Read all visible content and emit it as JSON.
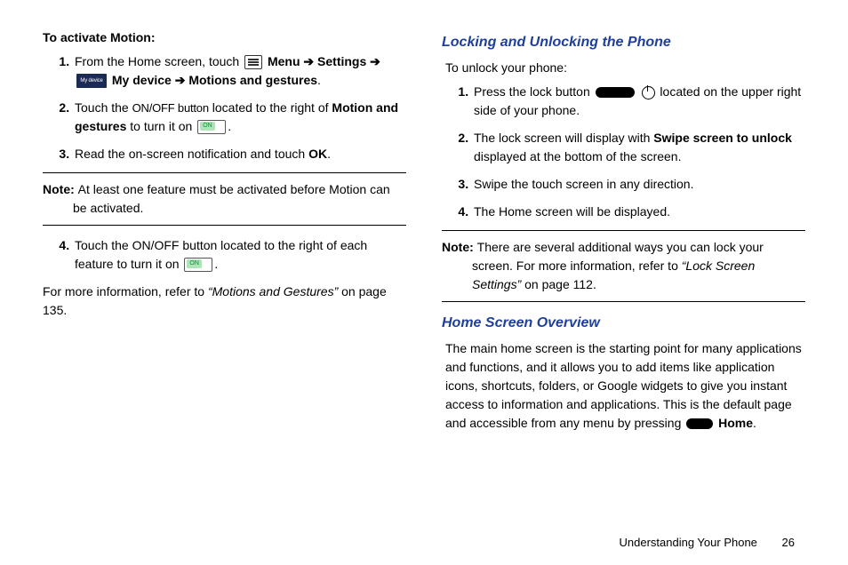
{
  "leftCol": {
    "activateHead": "To activate Motion:",
    "step1_from": "From the Home screen, touch ",
    "step1_menu": "Menu",
    "arrow": "➔",
    "step1_settings": "Settings",
    "step1_mydevice": "My device",
    "step1_motions": "Motions and gestures",
    "step2_a": "Touch the ",
    "step2_onoff": "ON/OFF button",
    "step2_b": " located to the right of ",
    "step2_motion": "Motion and gestures",
    "step2_c": " to turn it on ",
    "step3_a": "Read the on-screen notification and touch ",
    "step3_ok": "OK",
    "note_label": "Note: ",
    "note_text": "At least one feature must be activated before Motion can be activated.",
    "step4_a": "Touch the ON/OFF button located to the right of each feature to turn it on ",
    "moreinfo_a": "For more information, refer to ",
    "moreinfo_ref": "“Motions and Gestures”",
    "moreinfo_b": " on page 135."
  },
  "rightCol": {
    "h1": "Locking and Unlocking the Phone",
    "intro": "To unlock your phone:",
    "step1_a": "Press the lock button ",
    "step1_b": " located on the upper right side of your phone.",
    "step2_a": "The lock screen will display with ",
    "step2_swipe": "Swipe screen to unlock",
    "step2_b": " displayed at the bottom of the screen.",
    "step3": "Swipe the touch screen in any direction.",
    "step4": "The Home screen will be displayed.",
    "note_label": "Note: ",
    "note_a": "There are several additional ways you can lock your screen. For more information, refer to ",
    "note_ref": "“Lock Screen Settings”",
    "note_b": " on page 112.",
    "h2": "Home Screen Overview",
    "overview_a": "The main home screen is the starting point for many applications and functions, and it allows you to add items like application icons, shortcuts, folders, or Google widgets to give you instant access to information and applications. This is the default page and accessible from any menu by pressing ",
    "overview_home": "Home"
  },
  "footer": {
    "section": "Understanding Your Phone",
    "page": "26"
  }
}
